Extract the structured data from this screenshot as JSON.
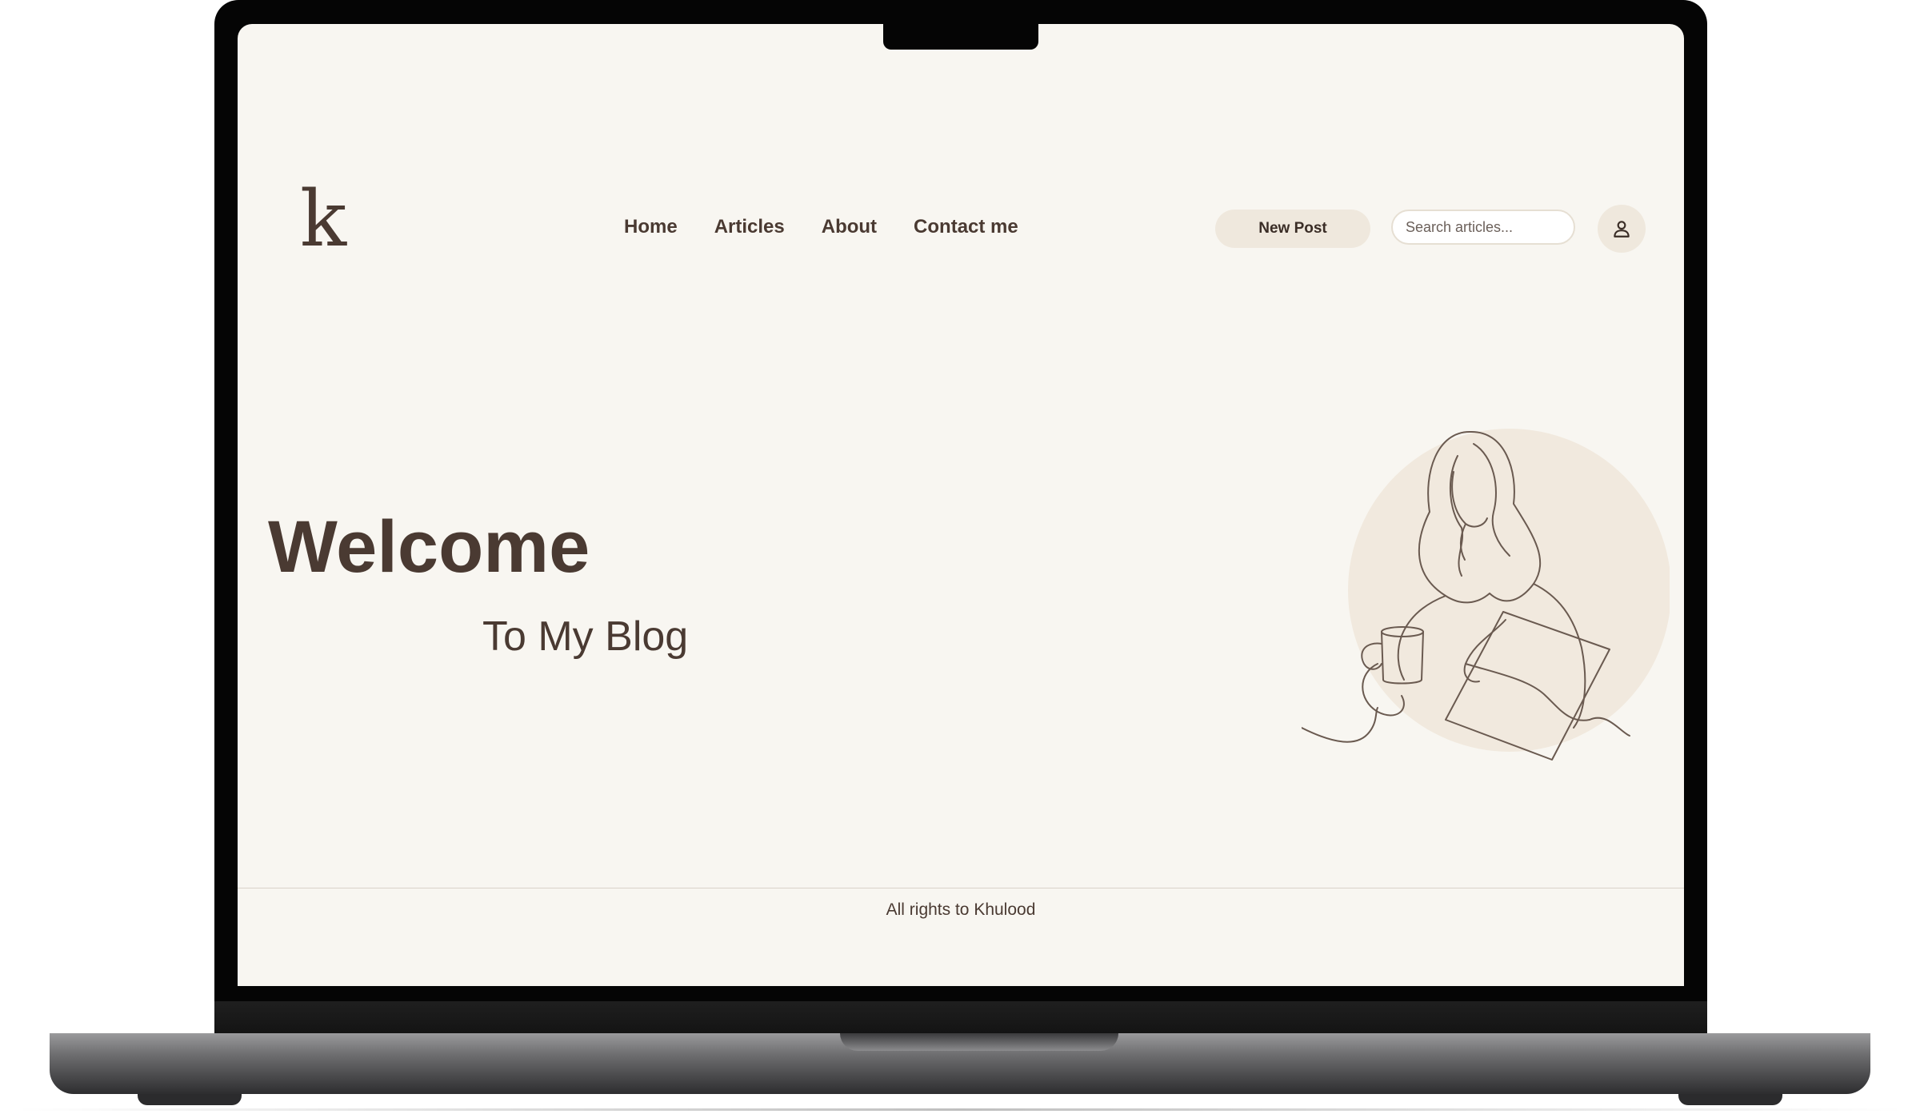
{
  "site": {
    "logo_text": "k"
  },
  "nav": {
    "items": [
      {
        "label": "Home"
      },
      {
        "label": "Articles"
      },
      {
        "label": "About"
      },
      {
        "label": "Contact me"
      }
    ]
  },
  "header": {
    "new_post_label": "New Post",
    "search_placeholder": "Search articles...",
    "search_value": ""
  },
  "hero": {
    "title": "Welcome",
    "subtitle": "To My Blog"
  },
  "footer": {
    "text": "All rights to Khulood"
  },
  "icons": {
    "user": "user-icon",
    "illustration": "woman-reading-line-drawing"
  },
  "colors": {
    "background": "#f8f6f1",
    "text": "#4a3a32",
    "accent_soft": "#efe8dd"
  }
}
